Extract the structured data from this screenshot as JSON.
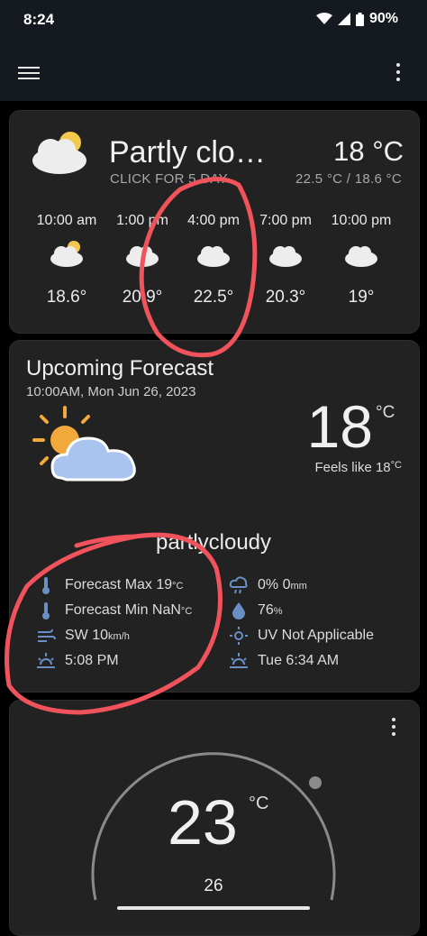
{
  "status": {
    "time": "8:24",
    "battery": "90%"
  },
  "current": {
    "condition": "Partly clo…",
    "subtitle": "CLICK FOR 5 DAY",
    "temp": "18 °C",
    "range": "22.5 °C / 18.6 °C",
    "hourly": [
      {
        "time": "10:00 am",
        "temp": "18.6°",
        "icon": "partly-cloudy-icon"
      },
      {
        "time": "1:00 pm",
        "temp": "20.9°",
        "icon": "cloud-icon"
      },
      {
        "time": "4:00 pm",
        "temp": "22.5°",
        "icon": "cloud-icon"
      },
      {
        "time": "7:00 pm",
        "temp": "20.3°",
        "icon": "cloud-icon"
      },
      {
        "time": "10:00 pm",
        "temp": "19°",
        "icon": "cloud-icon"
      }
    ]
  },
  "forecast": {
    "title": "Upcoming Forecast",
    "datetime": "10:00AM, Mon Jun 26, 2023",
    "temp": "18",
    "temp_unit": "°C",
    "feels_like": "Feels like 18",
    "feels_unit": "°C",
    "condition": "partlycloudy",
    "max_label": "Forecast Max 19",
    "min_label": "Forecast Min NaN",
    "unit_c": "°C",
    "wind": "SW 10",
    "wind_unit": "km/h",
    "sunset": "5:08 PM",
    "rain": "0% 0",
    "rain_unit": "mm",
    "humidity": "76",
    "humidity_unit": "%",
    "uv": "UV Not Applicable",
    "sunrise": "Tue 6:34 AM"
  },
  "gauge": {
    "temp": "23",
    "unit": "°C",
    "sub": "26"
  },
  "colors": {
    "annotation": "#f0535b",
    "accent_icon": "#6a8fc4"
  }
}
